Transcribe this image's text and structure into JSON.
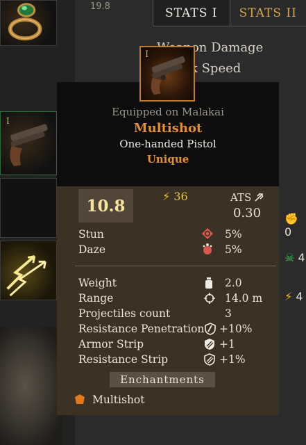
{
  "background": {
    "top_value": "19.8",
    "tabs": [
      {
        "label": "STATS I",
        "active": true
      },
      {
        "label": "STATS II",
        "active": false
      }
    ],
    "stat_lines": [
      "Weapon Damage",
      "Attack Speed"
    ],
    "equipment_slots": [
      {
        "tier": "",
        "icon": "ring-icon"
      },
      {
        "tier": "I",
        "icon": "pistol-icon"
      },
      {
        "tier": "",
        "icon": "empty-slot"
      },
      {
        "tier": "",
        "icon": "lightning-arrows-icon"
      }
    ],
    "side_icons": [
      {
        "icon": "fist-icon",
        "value": "0"
      },
      {
        "icon": "skull-icon",
        "value": "4"
      },
      {
        "icon": "bolt-icon",
        "value": "4"
      }
    ]
  },
  "tooltip": {
    "tier": "I",
    "equipped_on": "Equipped on Malakai",
    "name": "Multishot",
    "type": "One-handed Pistol",
    "rarity": "Unique",
    "damage": "10.8",
    "stamina_cost": "36",
    "ats_label": "ATS",
    "ats_value": "0.30",
    "effects": [
      {
        "label": "Stun",
        "icon": "stun-icon",
        "value": "5%"
      },
      {
        "label": "Daze",
        "icon": "daze-icon",
        "value": "5%"
      }
    ],
    "attributes": [
      {
        "label": "Weight",
        "icon": "weight-icon",
        "value": "2.0"
      },
      {
        "label": "Range",
        "icon": "range-crosshair-icon",
        "value": "14.0 m"
      },
      {
        "label": "Projectiles count",
        "icon": "",
        "value": "3"
      },
      {
        "label": "Resistance Penetration",
        "icon": "resistance-penetration-icon",
        "value": "+10%"
      },
      {
        "label": "Armor Strip",
        "icon": "armor-strip-icon",
        "value": "+1"
      },
      {
        "label": "Resistance Strip",
        "icon": "resistance-strip-icon",
        "value": "+1%"
      }
    ],
    "enchantments_label": "Enchantments",
    "enchantments": [
      {
        "name": "Multishot",
        "icon": "enchantment-hex-icon",
        "color": "#e07a1e"
      }
    ]
  },
  "colors": {
    "rarity_orange": "#e58f2a",
    "stamina_yellow": "#f0c020",
    "tab_inactive_gold": "#d8a64a",
    "tooltip_body": "#3b3125"
  }
}
